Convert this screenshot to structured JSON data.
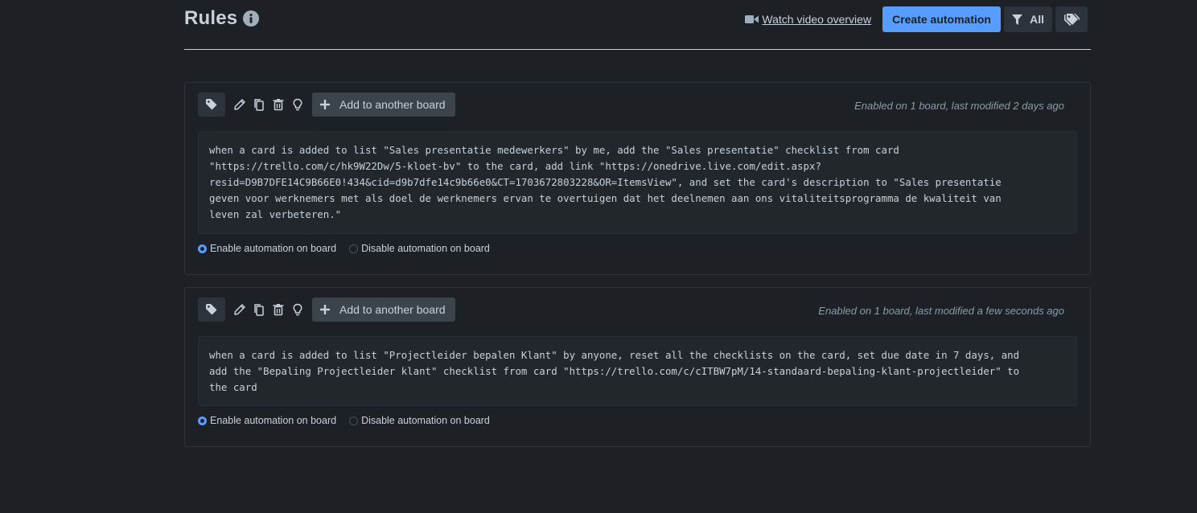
{
  "header": {
    "title": "Rules",
    "video_link": "Watch video overview",
    "create_button": "Create automation",
    "filter_label": "All"
  },
  "rules": [
    {
      "add_board_label": "Add to another board",
      "meta": "Enabled on 1 board, last modified 2 days ago",
      "text": "when a card is added to list \"Sales presentatie medewerkers\" by me, add the \"Sales presentatie\" checklist from card\n\"https://trello.com/c/hk9W22Dw/5-kloet-bv\" to the card, add link \"https://onedrive.live.com/edit.aspx?\nresid=D9B7DFE14C9B66E0!434&cid=d9b7dfe14c9b66e0&CT=1703672803228&OR=ItemsView\", and set the card's description to \"Sales presentatie\ngeven voor werknemers met als doel de werknemers ervan te overtuigen dat het deelnemen aan ons vitaliteitsprogramma de kwaliteit van\nleven zal verbeteren.\"",
      "enable_label": "Enable automation on board",
      "disable_label": "Disable automation on board",
      "enabled": true
    },
    {
      "add_board_label": "Add to another board",
      "meta": "Enabled on 1 board, last modified a few seconds ago",
      "text": "when a card is added to list \"Projectleider bepalen Klant\" by anyone, reset all the checklists on the card, set due date in 7 days, and\nadd the \"Bepaling Projectleider klant\" checklist from card \"https://trello.com/c/cITBW7pM/14-standaard-bepaling-klant-projectleider\" to\nthe card",
      "enable_label": "Enable automation on board",
      "disable_label": "Disable automation on board",
      "enabled": true
    }
  ],
  "colors": {
    "background": "#1d2125",
    "primary": "#579dff",
    "text": "#c7d1db",
    "muted": "#8c9bab"
  }
}
